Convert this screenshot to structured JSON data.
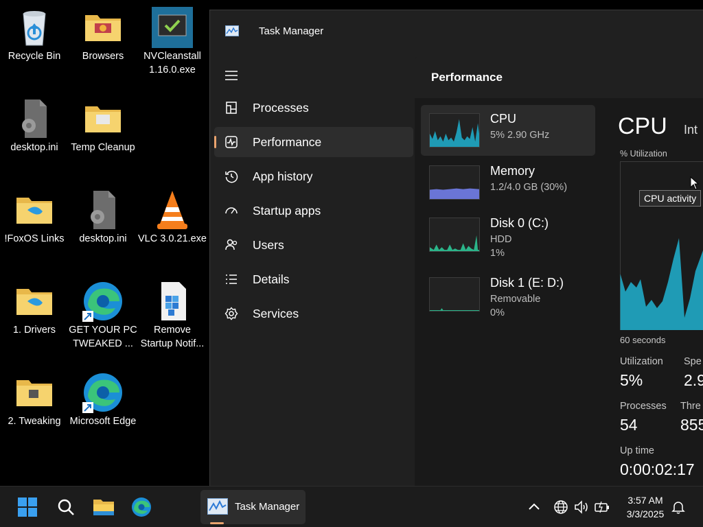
{
  "desktop": {
    "icons": [
      {
        "label": "Recycle Bin"
      },
      {
        "label": "Browsers"
      },
      {
        "label": "NVCleanstall 1.16.0.exe"
      },
      {
        "label": "desktop.ini"
      },
      {
        "label": "Temp Cleanup"
      },
      {
        "label": "!FoxOS Links"
      },
      {
        "label": "desktop.ini"
      },
      {
        "label": "VLC 3.0.21.exe"
      },
      {
        "label": "1. Drivers"
      },
      {
        "label": "GET YOUR PC TWEAKED ..."
      },
      {
        "label": "Remove Startup Notif..."
      },
      {
        "label": "2. Tweaking"
      },
      {
        "label": "Microsoft Edge"
      }
    ]
  },
  "task_manager": {
    "title": "Task Manager",
    "nav": [
      {
        "label": "Processes",
        "icon": "processes-icon"
      },
      {
        "label": "Performance",
        "icon": "performance-icon",
        "active": true
      },
      {
        "label": "App history",
        "icon": "history-icon"
      },
      {
        "label": "Startup apps",
        "icon": "startup-icon"
      },
      {
        "label": "Users",
        "icon": "users-icon"
      },
      {
        "label": "Details",
        "icon": "details-icon"
      },
      {
        "label": "Services",
        "icon": "services-icon"
      }
    ],
    "page_title": "Performance",
    "resources": [
      {
        "name": "CPU",
        "sub1": "5%  2.90 GHz",
        "sub2": ""
      },
      {
        "name": "Memory",
        "sub1": "1.2/4.0 GB (30%)",
        "sub2": ""
      },
      {
        "name": "Disk 0 (C:)",
        "sub1": "HDD",
        "sub2": "1%"
      },
      {
        "name": "Disk 1 (E: D:)",
        "sub1": "Removable",
        "sub2": "0%"
      }
    ],
    "detail": {
      "title": "CPU",
      "model_partial": "Int",
      "graph_label": "% Utilization",
      "time_label": "60 seconds",
      "tooltip": "CPU activity",
      "utilization_label": "Utilization",
      "utilization_value": "5%",
      "speed_label": "Spe",
      "speed_value": "2.9",
      "processes_label": "Processes",
      "processes_value": "54",
      "threads_label": "Thre",
      "threads_value": "855",
      "uptime_label": "Up time",
      "uptime_value": "0:00:02:17"
    }
  },
  "taskbar": {
    "task_label": "Task Manager",
    "time": "3:57 AM",
    "date": "3/3/2025"
  },
  "colors": {
    "accent": "#e9a36e",
    "cpu_graph": "#1f9bb5",
    "memory_graph": "#6a75d6"
  }
}
